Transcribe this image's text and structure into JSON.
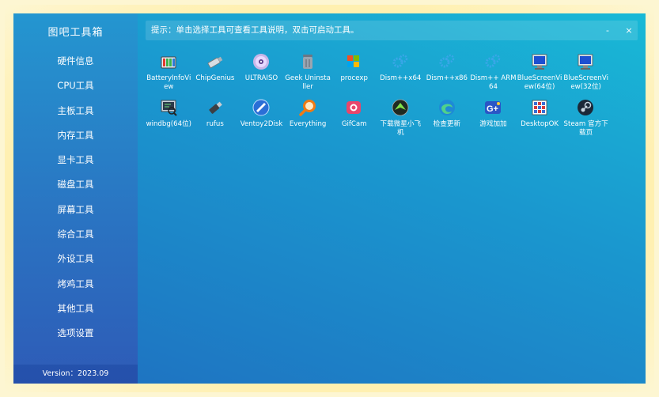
{
  "app": {
    "title": "图吧工具箱",
    "version": "Version：2023.09"
  },
  "sidebar": {
    "items": [
      {
        "label": "硬件信息"
      },
      {
        "label": "CPU工具"
      },
      {
        "label": "主板工具"
      },
      {
        "label": "内存工具"
      },
      {
        "label": "显卡工具"
      },
      {
        "label": "磁盘工具"
      },
      {
        "label": "屏幕工具"
      },
      {
        "label": "综合工具"
      },
      {
        "label": "外设工具"
      },
      {
        "label": "烤鸡工具"
      },
      {
        "label": "其他工具"
      },
      {
        "label": "选项设置"
      }
    ]
  },
  "header": {
    "hint": "提示：单击选择工具可查看工具说明，双击可启动工具。",
    "minimize": "-",
    "close": "×"
  },
  "tools": [
    {
      "label": "BatteryInfoView",
      "icon": "battery-icon"
    },
    {
      "label": "ChipGenius",
      "icon": "usb-drive-icon"
    },
    {
      "label": "ULTRAISO",
      "icon": "disc-icon"
    },
    {
      "label": "Geek Uninstaller",
      "icon": "trash-can-icon"
    },
    {
      "label": "procexp",
      "icon": "windows-flag-icon"
    },
    {
      "label": "Dism++x64",
      "icon": "gears-icon"
    },
    {
      "label": "Dism++x86",
      "icon": "gears-icon"
    },
    {
      "label": "Dism++ ARM64",
      "icon": "gears-icon"
    },
    {
      "label": "BlueScreenView(64位)",
      "icon": "monitor-icon"
    },
    {
      "label": "BlueScreenView(32位)",
      "icon": "monitor-icon"
    },
    {
      "label": "windbg(64位)",
      "icon": "debugger-monitor-icon"
    },
    {
      "label": "rufus",
      "icon": "usb-stick-icon"
    },
    {
      "label": "Ventoy2Disk",
      "icon": "ventoy-icon"
    },
    {
      "label": "Everything",
      "icon": "magnifier-icon"
    },
    {
      "label": "GifCam",
      "icon": "camera-icon"
    },
    {
      "label": "下载微星小飞机",
      "icon": "afterburner-icon"
    },
    {
      "label": "检查更新",
      "icon": "edge-icon"
    },
    {
      "label": "游戏加加",
      "icon": "game-plus-icon"
    },
    {
      "label": "DesktopOK",
      "icon": "desktop-grid-icon"
    },
    {
      "label": "Steam 官方下载页",
      "icon": "steam-icon"
    }
  ],
  "colors": {
    "sidebar_top": "#2496d0",
    "sidebar_bottom": "#2e5bb7",
    "main_top": "#19b9d6",
    "main_bottom": "#1f6fc0",
    "glow": "#ffe88a"
  }
}
